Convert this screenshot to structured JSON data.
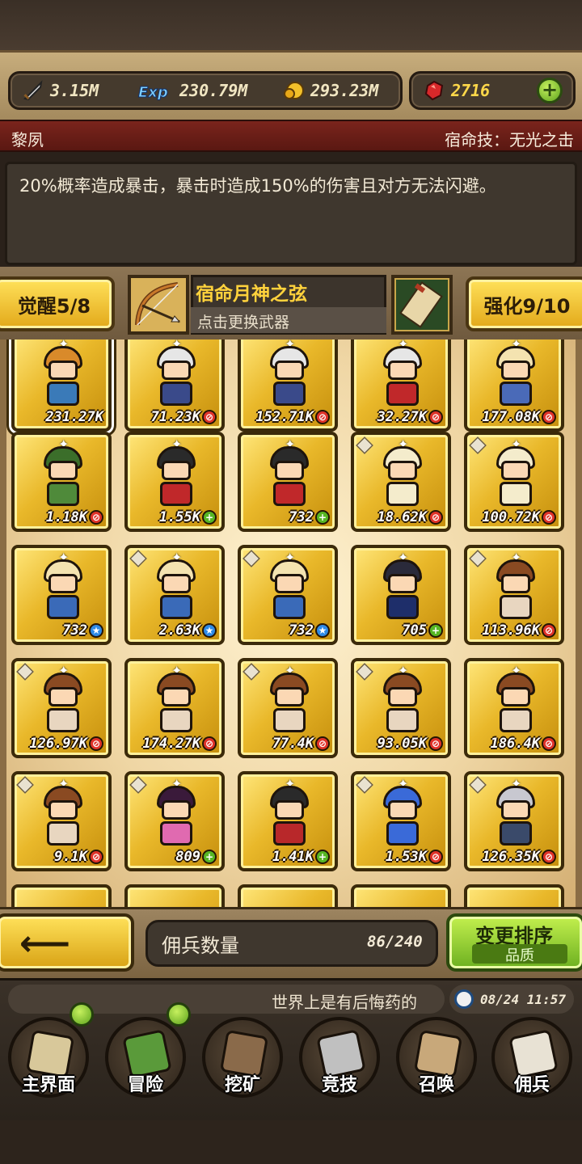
{
  "resources": {
    "attack": "3.15M",
    "exp": "230.79M",
    "gold": "293.23M",
    "gems": "2716",
    "exp_icon_text": "Exp"
  },
  "hero": {
    "name": "黎夙",
    "skill_title": "宿命技：无光之击",
    "description": "20%概率造成暴击，暴击时造成150%的伤害且对方无法闪避。"
  },
  "actions": {
    "awaken_label": "觉醒5/8",
    "weapon_name": "宿命月神之弦",
    "weapon_hint": "点击更换武器",
    "enhance_label": "强化9/10"
  },
  "mercenaries": [
    {
      "value": "231.27K",
      "badge": "none",
      "hair": "#d98a2a",
      "body": "#3a7ab8",
      "selected": true
    },
    {
      "value": "71.23K",
      "badge": "red",
      "hair": "#e6e6e6",
      "body": "#3a4a8a"
    },
    {
      "value": "152.71K",
      "badge": "red",
      "hair": "#e6e6e6",
      "body": "#3a4a8a"
    },
    {
      "value": "32.27K",
      "badge": "red",
      "hair": "#e6e6e6",
      "body": "#c0282a"
    },
    {
      "value": "177.08K",
      "badge": "red",
      "hair": "#f4e3b0",
      "body": "#4a6ab8"
    },
    {
      "value": "1.18K",
      "badge": "red",
      "hair": "#3b6e2a",
      "body": "#4f8a3a"
    },
    {
      "value": "1.55K",
      "badge": "green",
      "hair": "#2a2a2a",
      "body": "#c0282a"
    },
    {
      "value": "732",
      "badge": "green",
      "hair": "#2a2a2a",
      "body": "#c0282a"
    },
    {
      "value": "18.62K",
      "badge": "red",
      "hair": "#f4eccc",
      "body": "#f4eccc"
    },
    {
      "value": "100.72K",
      "badge": "red",
      "hair": "#f4eccc",
      "body": "#f4eccc"
    },
    {
      "value": "732",
      "badge": "blue",
      "hair": "#f4e3b0",
      "body": "#3a6ab8"
    },
    {
      "value": "2.63K",
      "badge": "blue",
      "hair": "#f4e3b0",
      "body": "#3a6ab8"
    },
    {
      "value": "732",
      "badge": "blue",
      "hair": "#f4e3b0",
      "body": "#3a6ab8"
    },
    {
      "value": "705",
      "badge": "green",
      "hair": "#2a2a3a",
      "body": "#1e2e6a"
    },
    {
      "value": "113.96K",
      "badge": "red",
      "hair": "#8a4a22",
      "body": "#e8d6c0"
    },
    {
      "value": "126.97K",
      "badge": "red",
      "hair": "#8a4a22",
      "body": "#e8d6c0"
    },
    {
      "value": "174.27K",
      "badge": "red",
      "hair": "#8a4a22",
      "body": "#e8d6c0"
    },
    {
      "value": "77.4K",
      "badge": "red",
      "hair": "#8a4a22",
      "body": "#e8d6c0"
    },
    {
      "value": "93.05K",
      "badge": "red",
      "hair": "#8a4a22",
      "body": "#e8d6c0"
    },
    {
      "value": "186.4K",
      "badge": "red",
      "hair": "#8a4a22",
      "body": "#e8d6c0"
    },
    {
      "value": "9.1K",
      "badge": "red",
      "hair": "#8a4a22",
      "body": "#e8d6c0"
    },
    {
      "value": "809",
      "badge": "green",
      "hair": "#3a1a3a",
      "body": "#e06ab0"
    },
    {
      "value": "1.41K",
      "badge": "green",
      "hair": "#2a2a2a",
      "body": "#b8282a"
    },
    {
      "value": "1.53K",
      "badge": "red",
      "hair": "#3a6ad8",
      "body": "#3a6ad8"
    },
    {
      "value": "126.35K",
      "badge": "red",
      "hair": "#c8c8d0",
      "body": "#3a4a6a"
    }
  ],
  "bottom_bar": {
    "count_label": "佣兵数量",
    "count_value": "86/240",
    "sort_label": "变更排序",
    "sort_sub": "品质"
  },
  "ticker": {
    "text": "世界上是有后悔药的",
    "time": "08/24 11:57"
  },
  "nav": [
    {
      "label": "主界面",
      "icon": "map-scroll-icon",
      "dot": true
    },
    {
      "label": "冒险",
      "icon": "island-icon",
      "dot": true
    },
    {
      "label": "挖矿",
      "icon": "pickaxe-icon",
      "dot": false
    },
    {
      "label": "竞技",
      "icon": "crossed-swords-icon",
      "dot": false
    },
    {
      "label": "召唤",
      "icon": "summon-scroll-icon",
      "dot": false
    },
    {
      "label": "佣兵",
      "icon": "tent-icon",
      "dot": false
    }
  ],
  "colors": {
    "gold_card": "#e9b82a",
    "name_bar": "#7a241c",
    "accent_green": "#6cb020"
  }
}
